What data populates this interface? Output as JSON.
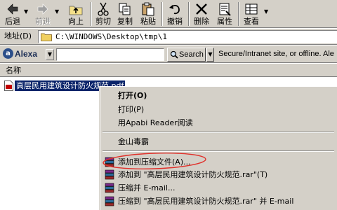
{
  "toolbar": {
    "back_label": "后退",
    "forward_label": "前进",
    "up_label": "向上",
    "cut_label": "剪切",
    "copy_label": "复制",
    "paste_label": "粘贴",
    "undo_label": "撤销",
    "delete_label": "删除",
    "properties_label": "属性",
    "view_label": "查看"
  },
  "address": {
    "label": "地址(D)",
    "value": "C:\\WINDOWS\\Desktop\\tmp\\1"
  },
  "alexa": {
    "logo_text": "Alexa",
    "search_label": "Search",
    "status_text": "Secure/Intranet site, or offline. Ale"
  },
  "list": {
    "column_name": "名称",
    "file_name": "高层民用建筑设计防火规范.pdf"
  },
  "context_menu": {
    "items": [
      {
        "label": "打开(O)",
        "bold": true
      },
      {
        "label": "打印(P)"
      },
      {
        "label": "用Apabi Reader阅读"
      },
      {
        "label": "金山毒霸"
      },
      {
        "label": "添加到压缩文件(A)..."
      },
      {
        "label": "添加到 \"高层民用建筑设计防火规范.rar\"(T)"
      },
      {
        "label": "压缩并 E-mail..."
      },
      {
        "label": "压缩到 \"高层民用建筑设计防火规范.rar\" 并 E-mail"
      }
    ]
  },
  "colors": {
    "toolbar_bg": "#d4d0c8",
    "selection_bg": "#0a246a",
    "annotation_red": "#e0302a"
  }
}
